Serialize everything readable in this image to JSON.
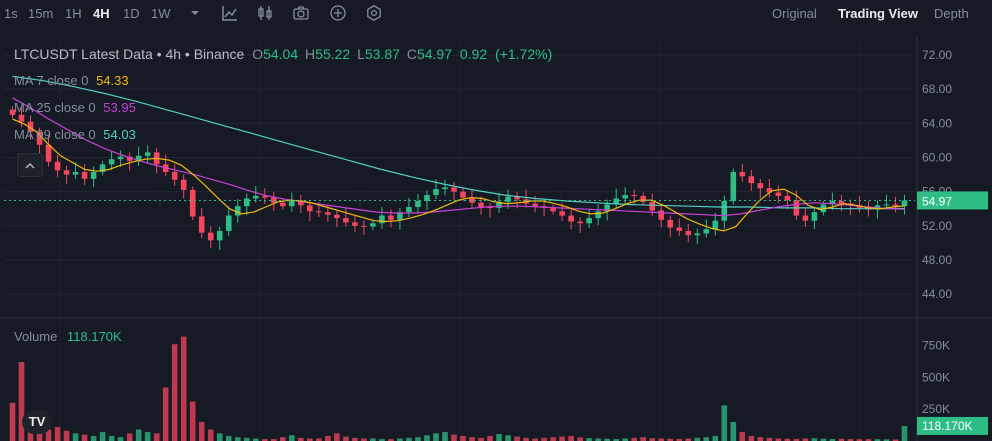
{
  "toolbar": {
    "timeframes": [
      "1s",
      "15m",
      "1H",
      "4H",
      "1D",
      "1W"
    ],
    "active_timeframe": "4H",
    "icons": [
      "chevron-down-icon",
      "draw-line-icon",
      "candle-type-icon",
      "camera-icon",
      "plus-circle-icon",
      "settings-icon"
    ],
    "views": [
      "Original",
      "Trading View",
      "Depth"
    ],
    "active_view": "Trading View"
  },
  "legend": {
    "symbol": "LTCUSDT Latest Data",
    "interval": "4h",
    "exchange": "Binance",
    "open_label": "O",
    "open": "54.04",
    "high_label": "H",
    "high": "55.22",
    "low_label": "L",
    "low": "53.87",
    "close_label": "C",
    "close": "54.97",
    "change": "0.92",
    "change_pct": "(+1.72%)",
    "ma7_label": "MA 7 close 0",
    "ma7_value": "54.33",
    "ma25_label": "MA 25 close 0",
    "ma25_value": "53.95",
    "ma99_label": "MA 99 close 0",
    "ma99_value": "54.03",
    "volume_label": "Volume",
    "volume_value": "118.170K",
    "current_price": "54.97",
    "current_volume": "118.170K",
    "logo": "TV"
  },
  "colors": {
    "up": "#2ebd85",
    "down": "#f6465d",
    "ma7": "#f0b90b",
    "ma25": "#c941d6",
    "ma99": "#4fd1c5",
    "background": "#161a25"
  },
  "chart_data": [
    {
      "type": "candlestick",
      "title": "LTCUSDT Latest Data",
      "y_ticks": [
        44.0,
        48.0,
        52.0,
        56.0,
        60.0,
        64.0,
        68.0,
        72.0
      ],
      "ylim": [
        41.2,
        74.0
      ],
      "last_price": 54.97,
      "close_series": [
        65,
        64.2,
        63,
        61.5,
        59.5,
        58.5,
        58,
        58.3,
        57.5,
        58.3,
        59.2,
        59.8,
        60.1,
        59.6,
        60.2,
        60.6,
        59.2,
        58.3,
        57.4,
        56.2,
        53.1,
        51.2,
        50.3,
        51.4,
        53.2,
        54.3,
        55.2,
        55.5,
        55.3,
        54.7,
        54.3,
        54.9,
        54.4,
        53.7,
        53.6,
        53.3,
        52.9,
        52.4,
        52.0,
        51.9,
        52.3,
        53.2,
        52.7,
        53.6,
        54.2,
        54.9,
        55.6,
        56.3,
        56.5,
        56.0,
        55.3,
        54.7,
        54.2,
        54.1,
        54.8,
        55.4,
        55.1,
        54.6,
        54.3,
        54.1,
        53.7,
        53.2,
        52.5,
        52.3,
        52.9,
        53.7,
        54.5,
        55.2,
        55.6,
        55.5,
        54.8,
        53.8,
        52.7,
        51.8,
        51.4,
        50.9,
        51.1,
        51.6,
        52.6,
        54.9,
        58.3,
        57.8,
        57.0,
        56.4,
        55.9,
        55.5,
        55.0,
        53.2,
        52.6,
        53.6,
        54.5,
        54.9,
        54.6,
        54.4,
        54.1,
        53.9,
        54.4,
        54.5,
        54.3,
        54.97
      ],
      "ma7_series": [
        64.5,
        63.9,
        63.0,
        61.5,
        60.2,
        59.4,
        58.6,
        58.4,
        58.6,
        59.1,
        59.5,
        59.8,
        59.9,
        59.7,
        59.1,
        58.0,
        56.7,
        55.3,
        54.0,
        53.4,
        53.6,
        54.2,
        54.8,
        55.0,
        54.9,
        54.6,
        54.2,
        53.8,
        53.4,
        53.0,
        52.6,
        52.5,
        52.6,
        52.9,
        53.3,
        53.8,
        54.4,
        55.0,
        55.3,
        55.2,
        54.8,
        54.6,
        54.7,
        54.9,
        54.9,
        54.6,
        54.2,
        53.7,
        53.4,
        53.5,
        54.0,
        54.6,
        55.0,
        55.0,
        54.4,
        53.6,
        52.8,
        52.2,
        51.7,
        51.4,
        51.9,
        53.5,
        55.0,
        56.1,
        56.3,
        55.6,
        54.4,
        53.9,
        54.2,
        54.6,
        54.4,
        54.1,
        54.0,
        54.2,
        54.33
      ],
      "ma25_series": [
        67.0,
        65.8,
        64.5,
        63.3,
        62.1,
        61.1,
        60.3,
        59.6,
        59.0,
        58.5,
        58.0,
        57.4,
        56.8,
        56.1,
        55.5,
        55.1,
        54.8,
        54.5,
        54.2,
        53.9,
        53.6,
        53.5,
        53.5,
        53.6,
        53.8,
        54.0,
        54.2,
        54.3,
        54.3,
        54.2,
        54.1,
        54.0,
        53.9,
        53.8,
        53.7,
        53.6,
        53.5,
        53.4,
        53.3,
        53.2,
        53.4,
        53.8,
        54.2,
        54.5,
        54.7,
        54.6,
        54.4,
        54.2,
        54.0,
        53.95
      ],
      "ma99_series": [
        69.5,
        69.0,
        68.3,
        67.5,
        66.6,
        65.6,
        64.6,
        63.6,
        62.6,
        61.6,
        60.6,
        59.6,
        58.6,
        57.7,
        56.9,
        56.2,
        55.6,
        55.2,
        54.9,
        54.7,
        54.5,
        54.4,
        54.3,
        54.2,
        54.2,
        54.1,
        54.1,
        54.0,
        54.0,
        54.03
      ]
    },
    {
      "type": "bar",
      "title": "Volume",
      "y_ticks": [
        "250K",
        "500K",
        "750K"
      ],
      "ylim": [
        0,
        950000
      ],
      "values": [
        300000,
        620000,
        180000,
        150000,
        90000,
        110000,
        80000,
        60000,
        50000,
        40000,
        70000,
        40000,
        30000,
        60000,
        90000,
        70000,
        60000,
        420000,
        760000,
        820000,
        310000,
        150000,
        90000,
        60000,
        40000,
        30000,
        25000,
        20000,
        15000,
        15000,
        30000,
        45000,
        25000,
        20000,
        20000,
        40000,
        60000,
        35000,
        25000,
        20000,
        20000,
        15000,
        15000,
        20000,
        25000,
        30000,
        45000,
        60000,
        70000,
        50000,
        40000,
        30000,
        25000,
        40000,
        55000,
        45000,
        35000,
        25000,
        20000,
        25000,
        30000,
        35000,
        40000,
        28000,
        22000,
        20000,
        18000,
        15000,
        20000,
        25000,
        30000,
        22000,
        20000,
        18000,
        16000,
        20000,
        25000,
        30000,
        40000,
        280000,
        150000,
        70000,
        40000,
        30000,
        25000,
        20000,
        18000,
        16000,
        20000,
        22000,
        18000,
        16000,
        18000,
        15000,
        14000,
        15000,
        14000,
        13000,
        12000,
        118170
      ],
      "last_value": 118170
    }
  ]
}
